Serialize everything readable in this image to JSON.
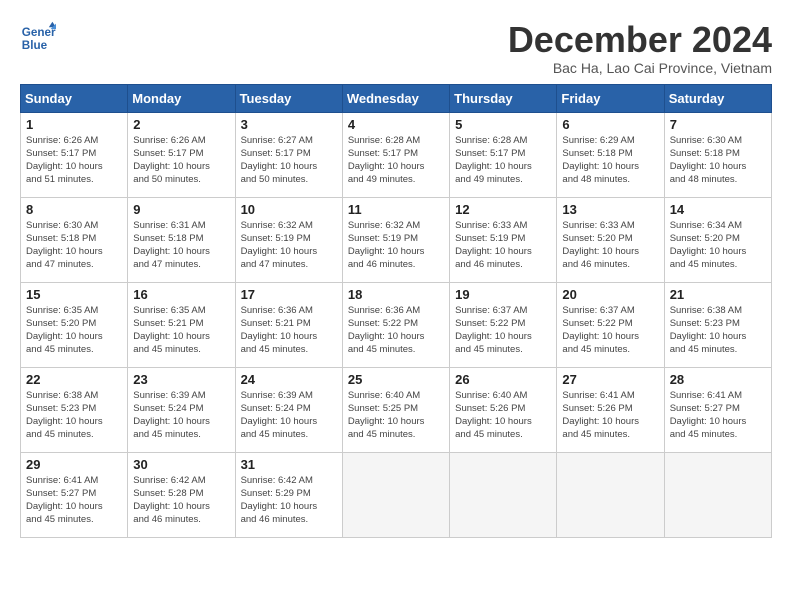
{
  "logo": {
    "line1": "General",
    "line2": "Blue"
  },
  "title": "December 2024",
  "subtitle": "Bac Ha, Lao Cai Province, Vietnam",
  "weekdays": [
    "Sunday",
    "Monday",
    "Tuesday",
    "Wednesday",
    "Thursday",
    "Friday",
    "Saturday"
  ],
  "weeks": [
    [
      {
        "day": "1",
        "info": "Sunrise: 6:26 AM\nSunset: 5:17 PM\nDaylight: 10 hours\nand 51 minutes."
      },
      {
        "day": "2",
        "info": "Sunrise: 6:26 AM\nSunset: 5:17 PM\nDaylight: 10 hours\nand 50 minutes."
      },
      {
        "day": "3",
        "info": "Sunrise: 6:27 AM\nSunset: 5:17 PM\nDaylight: 10 hours\nand 50 minutes."
      },
      {
        "day": "4",
        "info": "Sunrise: 6:28 AM\nSunset: 5:17 PM\nDaylight: 10 hours\nand 49 minutes."
      },
      {
        "day": "5",
        "info": "Sunrise: 6:28 AM\nSunset: 5:17 PM\nDaylight: 10 hours\nand 49 minutes."
      },
      {
        "day": "6",
        "info": "Sunrise: 6:29 AM\nSunset: 5:18 PM\nDaylight: 10 hours\nand 48 minutes."
      },
      {
        "day": "7",
        "info": "Sunrise: 6:30 AM\nSunset: 5:18 PM\nDaylight: 10 hours\nand 48 minutes."
      }
    ],
    [
      {
        "day": "8",
        "info": "Sunrise: 6:30 AM\nSunset: 5:18 PM\nDaylight: 10 hours\nand 47 minutes."
      },
      {
        "day": "9",
        "info": "Sunrise: 6:31 AM\nSunset: 5:18 PM\nDaylight: 10 hours\nand 47 minutes."
      },
      {
        "day": "10",
        "info": "Sunrise: 6:32 AM\nSunset: 5:19 PM\nDaylight: 10 hours\nand 47 minutes."
      },
      {
        "day": "11",
        "info": "Sunrise: 6:32 AM\nSunset: 5:19 PM\nDaylight: 10 hours\nand 46 minutes."
      },
      {
        "day": "12",
        "info": "Sunrise: 6:33 AM\nSunset: 5:19 PM\nDaylight: 10 hours\nand 46 minutes."
      },
      {
        "day": "13",
        "info": "Sunrise: 6:33 AM\nSunset: 5:20 PM\nDaylight: 10 hours\nand 46 minutes."
      },
      {
        "day": "14",
        "info": "Sunrise: 6:34 AM\nSunset: 5:20 PM\nDaylight: 10 hours\nand 45 minutes."
      }
    ],
    [
      {
        "day": "15",
        "info": "Sunrise: 6:35 AM\nSunset: 5:20 PM\nDaylight: 10 hours\nand 45 minutes."
      },
      {
        "day": "16",
        "info": "Sunrise: 6:35 AM\nSunset: 5:21 PM\nDaylight: 10 hours\nand 45 minutes."
      },
      {
        "day": "17",
        "info": "Sunrise: 6:36 AM\nSunset: 5:21 PM\nDaylight: 10 hours\nand 45 minutes."
      },
      {
        "day": "18",
        "info": "Sunrise: 6:36 AM\nSunset: 5:22 PM\nDaylight: 10 hours\nand 45 minutes."
      },
      {
        "day": "19",
        "info": "Sunrise: 6:37 AM\nSunset: 5:22 PM\nDaylight: 10 hours\nand 45 minutes."
      },
      {
        "day": "20",
        "info": "Sunrise: 6:37 AM\nSunset: 5:22 PM\nDaylight: 10 hours\nand 45 minutes."
      },
      {
        "day": "21",
        "info": "Sunrise: 6:38 AM\nSunset: 5:23 PM\nDaylight: 10 hours\nand 45 minutes."
      }
    ],
    [
      {
        "day": "22",
        "info": "Sunrise: 6:38 AM\nSunset: 5:23 PM\nDaylight: 10 hours\nand 45 minutes."
      },
      {
        "day": "23",
        "info": "Sunrise: 6:39 AM\nSunset: 5:24 PM\nDaylight: 10 hours\nand 45 minutes."
      },
      {
        "day": "24",
        "info": "Sunrise: 6:39 AM\nSunset: 5:24 PM\nDaylight: 10 hours\nand 45 minutes."
      },
      {
        "day": "25",
        "info": "Sunrise: 6:40 AM\nSunset: 5:25 PM\nDaylight: 10 hours\nand 45 minutes."
      },
      {
        "day": "26",
        "info": "Sunrise: 6:40 AM\nSunset: 5:26 PM\nDaylight: 10 hours\nand 45 minutes."
      },
      {
        "day": "27",
        "info": "Sunrise: 6:41 AM\nSunset: 5:26 PM\nDaylight: 10 hours\nand 45 minutes."
      },
      {
        "day": "28",
        "info": "Sunrise: 6:41 AM\nSunset: 5:27 PM\nDaylight: 10 hours\nand 45 minutes."
      }
    ],
    [
      {
        "day": "29",
        "info": "Sunrise: 6:41 AM\nSunset: 5:27 PM\nDaylight: 10 hours\nand 45 minutes."
      },
      {
        "day": "30",
        "info": "Sunrise: 6:42 AM\nSunset: 5:28 PM\nDaylight: 10 hours\nand 46 minutes."
      },
      {
        "day": "31",
        "info": "Sunrise: 6:42 AM\nSunset: 5:29 PM\nDaylight: 10 hours\nand 46 minutes."
      },
      null,
      null,
      null,
      null
    ]
  ]
}
